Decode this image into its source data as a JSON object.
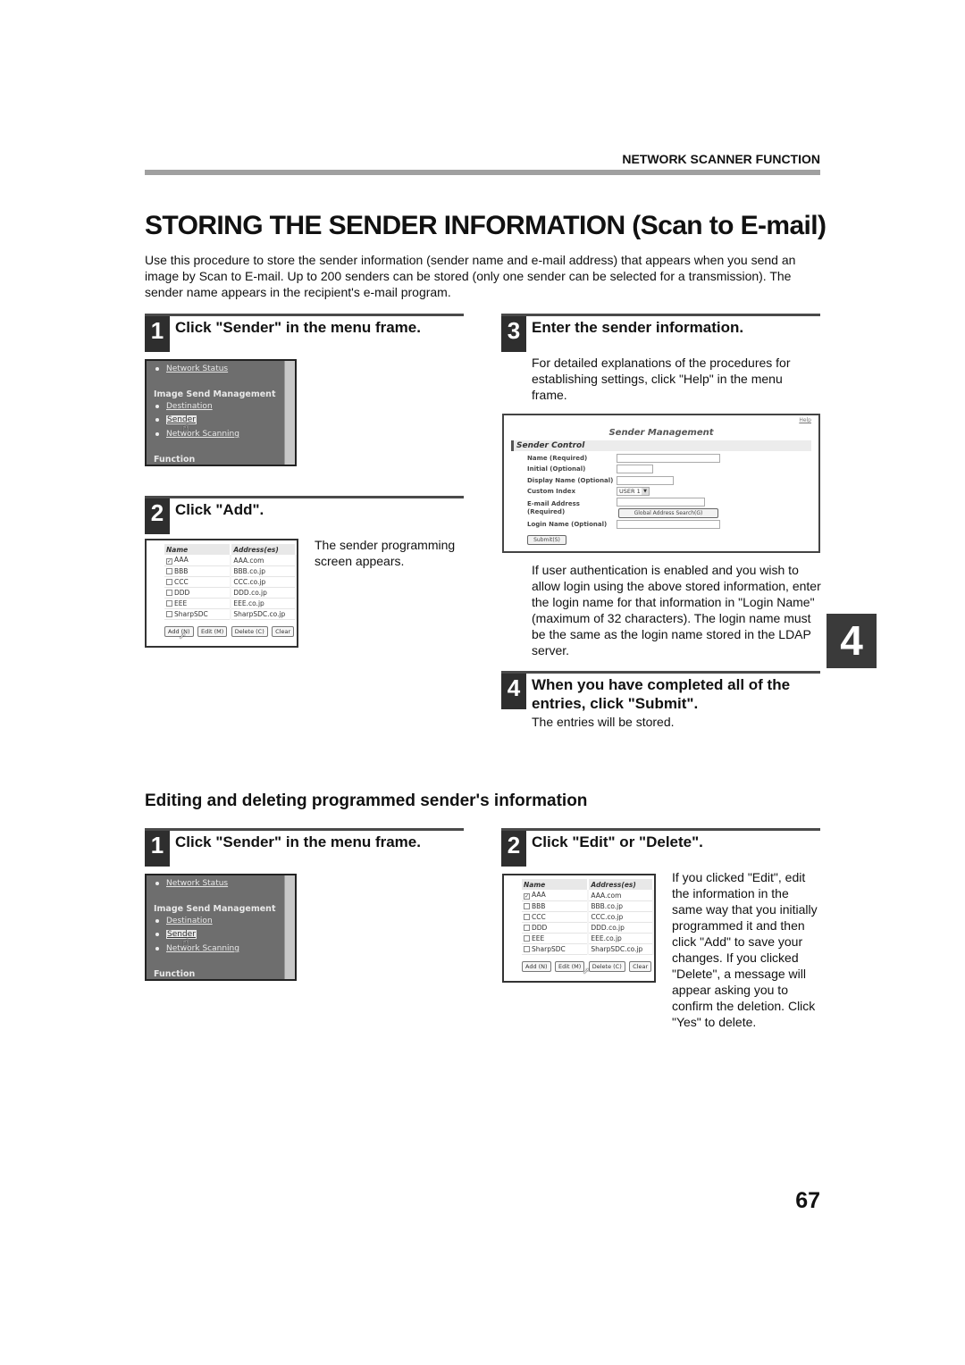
{
  "header": {
    "section": "NETWORK SCANNER FUNCTION",
    "title": "STORING THE SENDER INFORMATION (Scan to E-mail)",
    "intro": "Use this procedure to store the sender information (sender name and e-mail address) that appears when you send an image by Scan to E-mail. Up to 200 senders can be stored (only one sender can be selected for a transmission). The sender name appears in the recipient's e-mail program."
  },
  "store_steps": [
    {
      "num": "1",
      "title": "Click \"Sender\" in the menu frame."
    },
    {
      "num": "2",
      "title": "Click \"Add\".",
      "text": "The sender programming screen appears."
    },
    {
      "num": "3",
      "title": "Enter the sender information.",
      "text": "For detailed explanations of the procedures for establishing settings, click \"Help\" in the menu frame.",
      "note": "If user authentication is enabled and you wish to allow login using the above stored information, enter the login name for that information in \"Login Name\" (maximum of 32 characters). The login name must be the same as the login name stored in the LDAP server."
    },
    {
      "num": "4",
      "title": "When you have completed all of the entries, click \"Submit\".",
      "text": "The entries will be stored."
    }
  ],
  "menu_frame": {
    "network_status": "Network Status",
    "heading": "Image Send Management",
    "items": [
      "Destination",
      "Sender",
      "Network Scanning"
    ],
    "function": "Function"
  },
  "sender_list": {
    "columns": [
      "Name",
      "Address(es)"
    ],
    "rows": [
      {
        "name": "AAA",
        "address": "AAA.com",
        "checked": true
      },
      {
        "name": "BBB",
        "address": "BBB.co.jp",
        "checked": false
      },
      {
        "name": "CCC",
        "address": "CCC.co.jp",
        "checked": false
      },
      {
        "name": "DDD",
        "address": "DDD.co.jp",
        "checked": false
      },
      {
        "name": "EEE",
        "address": "EEE.co.jp",
        "checked": false
      },
      {
        "name": "SharpSDC",
        "address": "SharpSDC.co.jp",
        "checked": false
      }
    ],
    "buttons": [
      "Add (N)",
      "Edit (M)",
      "Delete (C)",
      "Clear"
    ]
  },
  "sender_form": {
    "help": "Help",
    "title": "Sender Management",
    "section": "Sender Control",
    "fields": [
      "Name (Required)",
      "Initial (Optional)",
      "Display Name (Optional)",
      "Custom Index",
      "E-mail Address",
      "(Required)",
      "Login Name (Optional)"
    ],
    "custom_index_value": "USER 1",
    "global_search_button": "Global Address Search(G)",
    "submit_button": "Submit(S)"
  },
  "chapter_tab": "4",
  "edit_section": {
    "heading": "Editing and deleting programmed sender's information",
    "steps": [
      {
        "num": "1",
        "title": "Click \"Sender\" in the menu frame."
      },
      {
        "num": "2",
        "title": "Click \"Edit\" or \"Delete\".",
        "text": "If you clicked \"Edit\", edit the information in the same way that you initially programmed it and then click \"Add\" to save your changes. If you clicked \"Delete\", a message will appear asking you to confirm the deletion. Click \"Yes\" to delete."
      }
    ]
  },
  "page_number": "67"
}
